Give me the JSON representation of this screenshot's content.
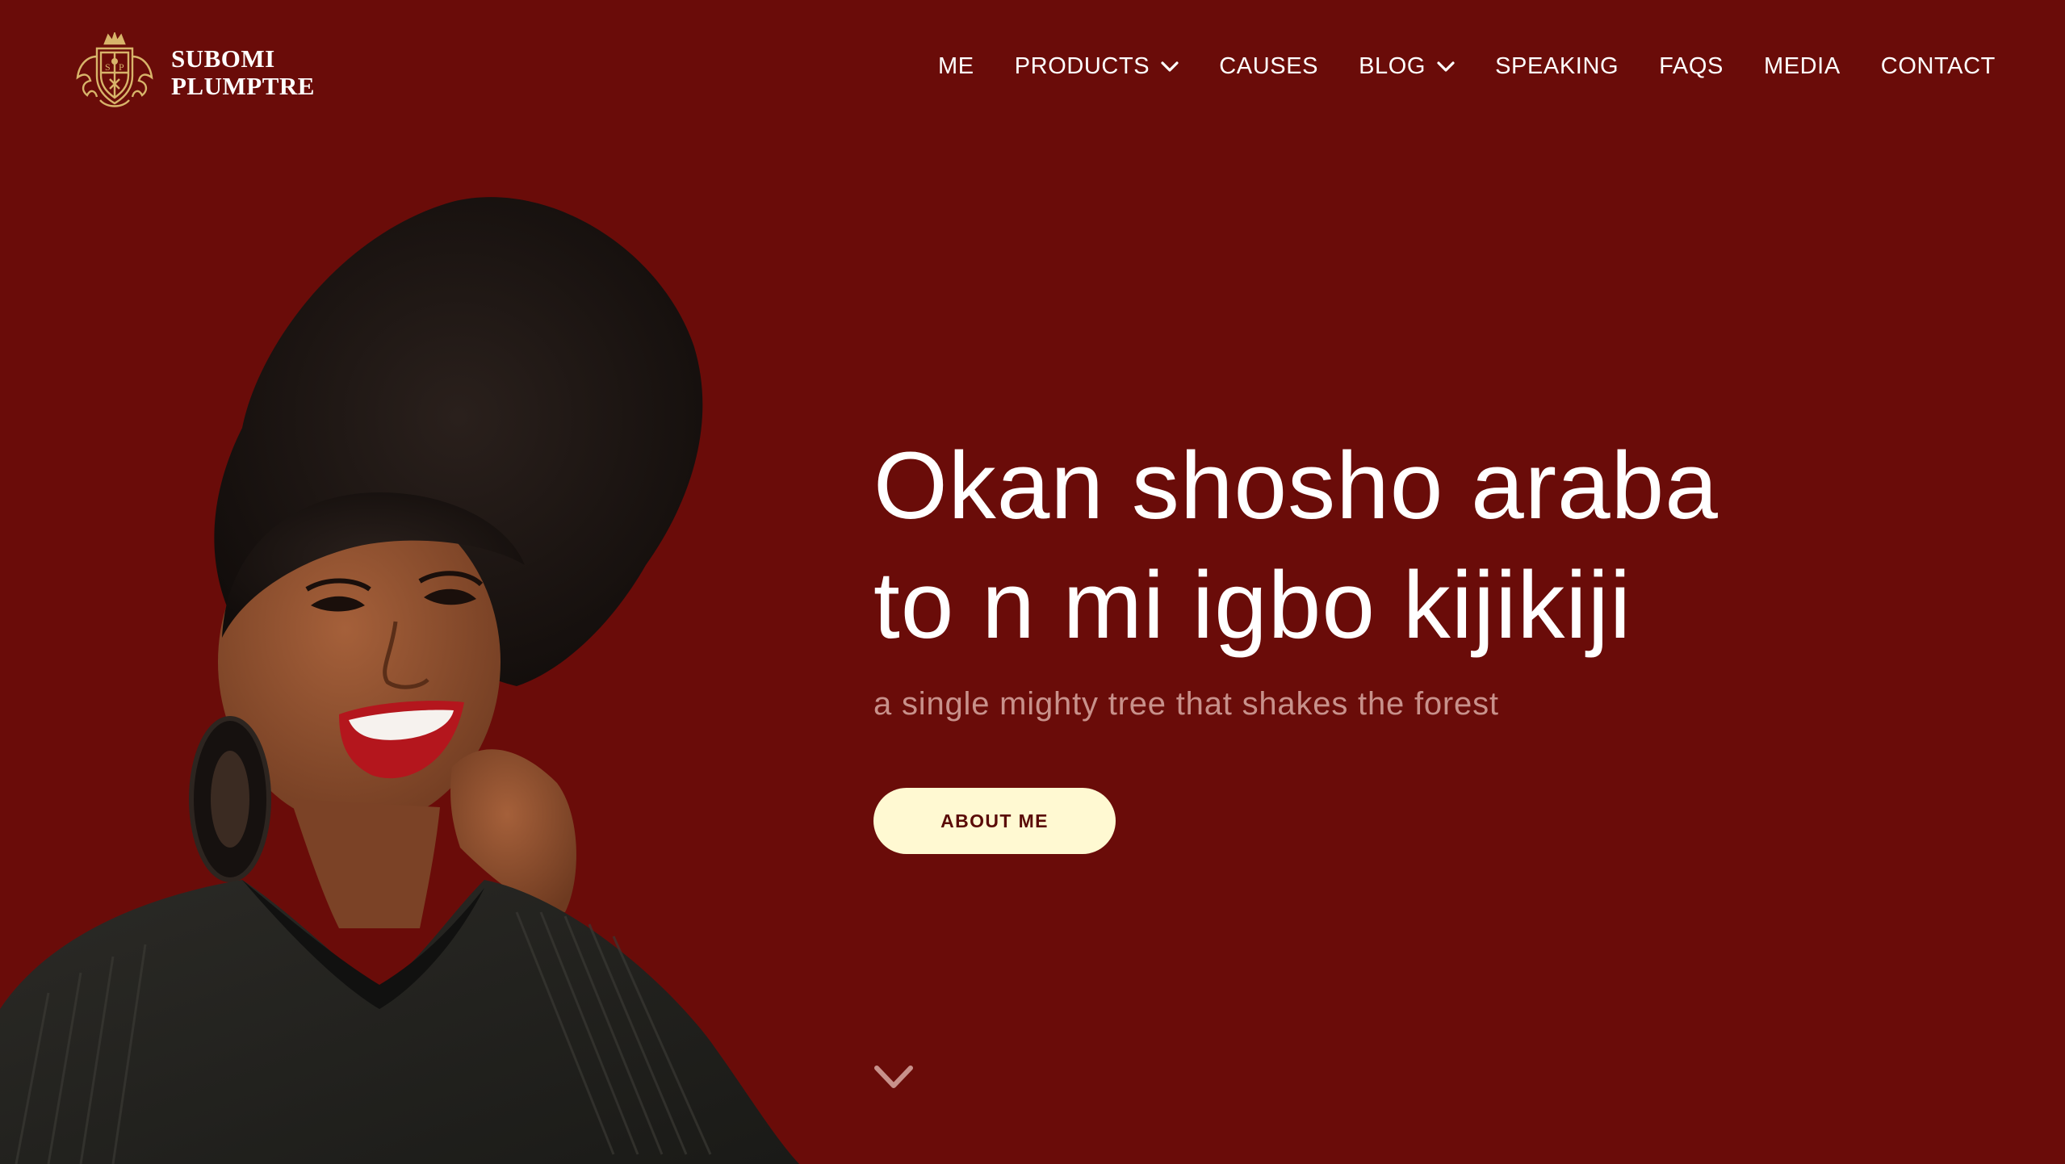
{
  "brand": {
    "name_line1": "SUBOMI",
    "name_line2": "PLUMPTRE",
    "crest_icon": "crest-logo-icon"
  },
  "nav": {
    "items": [
      {
        "label": "ME",
        "has_dropdown": false
      },
      {
        "label": "PRODUCTS",
        "has_dropdown": true
      },
      {
        "label": "CAUSES",
        "has_dropdown": false
      },
      {
        "label": "BLOG",
        "has_dropdown": true
      },
      {
        "label": "SPEAKING",
        "has_dropdown": false
      },
      {
        "label": "FAQS",
        "has_dropdown": false
      },
      {
        "label": "MEDIA",
        "has_dropdown": false
      },
      {
        "label": "CONTACT",
        "has_dropdown": false
      }
    ]
  },
  "hero": {
    "headline_line1": "Okan shosho araba",
    "headline_line2": "to n mi igbo kijikiji",
    "subline": "a single mighty tree that shakes the forest",
    "cta_label": "ABOUT ME",
    "scroll_icon": "chevron-down-icon"
  },
  "colors": {
    "background": "#6a0c09",
    "cta_background": "#fff9d2",
    "cta_text": "#5a0b08",
    "subline": "#c8918b",
    "nav_text": "#ffffff"
  }
}
